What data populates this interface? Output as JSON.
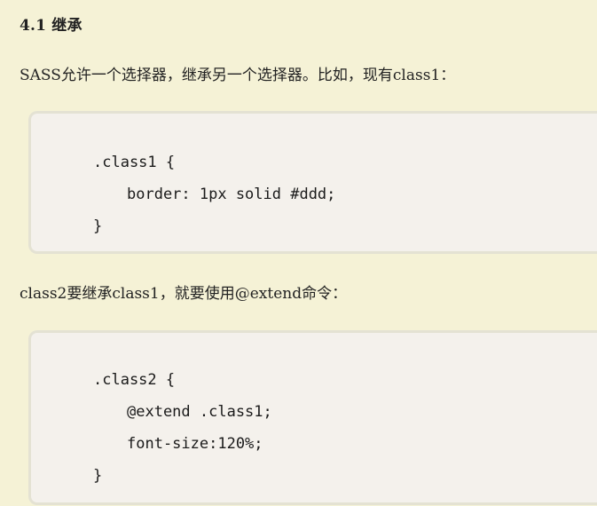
{
  "section": {
    "heading": "4.1 继承"
  },
  "paragraphs": {
    "intro": "SASS允许一个选择器，继承另一个选择器。比如，现有class1：",
    "extend_intro": "class2要继承class1，就要使用@extend命令："
  },
  "code_block_1": {
    "lines": [
      ".class1 {",
      "border: 1px solid #ddd;",
      "}"
    ]
  },
  "code_block_2": {
    "lines": [
      ".class2 {",
      "@extend .class1;",
      "font-size:120%;",
      "}"
    ]
  }
}
